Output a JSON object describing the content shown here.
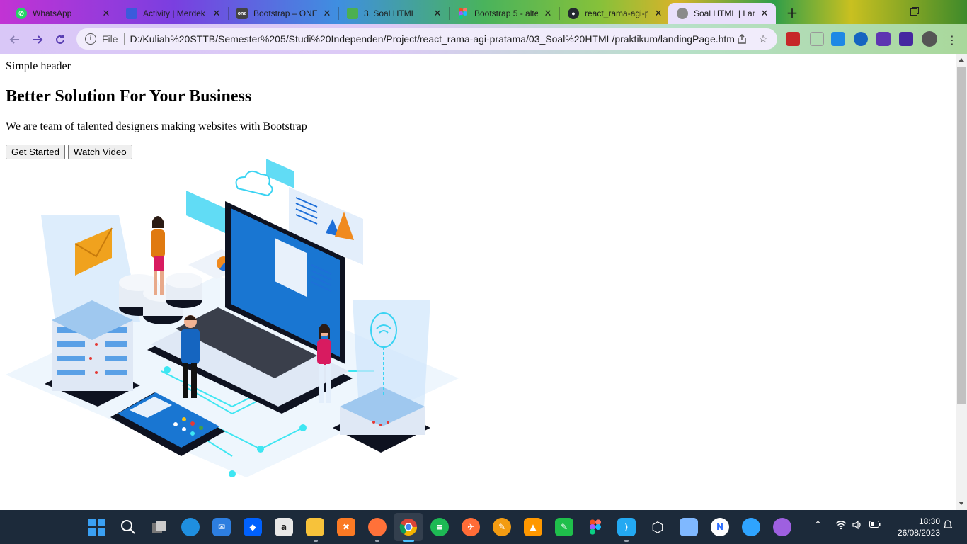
{
  "browser": {
    "tabs": [
      {
        "title": "WhatsApp",
        "icon": "whatsapp-icon",
        "color": "#25d366",
        "active": false
      },
      {
        "title": "Activity | Merdek",
        "icon": "kampus-merdeka-icon",
        "color": "#3b5bdb",
        "active": false
      },
      {
        "title": "Bootstrap – ONE",
        "icon": "one-icon",
        "color": "#444444",
        "active": false
      },
      {
        "title": "3. Soal HTML",
        "icon": "notebook-icon",
        "color": "#4caf50",
        "active": false
      },
      {
        "title": "Bootstrap 5 - alte",
        "icon": "figma-icon",
        "color": "#f24e1e",
        "active": false
      },
      {
        "title": "react_rama-agi-p",
        "icon": "github-icon",
        "color": "#24292f",
        "active": false
      },
      {
        "title": "Soal HTML | Landi",
        "icon": "globe-icon",
        "color": "#8a8a8a",
        "active": true
      }
    ],
    "close_glyph": "✕",
    "new_tab_glyph": "+",
    "address": {
      "scheme": "File",
      "url": "D:/Kuliah%20STTB/Semester%205/Studi%20Independen/Project/react_rama-agi-pratama/03_Soal%20HTML/praktikum/landingPage.html"
    }
  },
  "page": {
    "simple_header": "Simple header",
    "title": "Better Solution For Your Business",
    "subtitle": "We are team of talented designers making websites with Bootstrap",
    "buttons": {
      "get_started": "Get Started",
      "watch_video": "Watch Video"
    },
    "illustration": "isometric-laptop-datacenter-illustration"
  },
  "taskbar": {
    "apps": [
      {
        "name": "start-icon",
        "color": "#2f9bf0"
      },
      {
        "name": "search-icon",
        "color": "#1c2a3a"
      },
      {
        "name": "task-view-icon",
        "color": "#1c2a3a"
      },
      {
        "name": "edge-icon",
        "color": "#1f8fe0"
      },
      {
        "name": "mail-icon",
        "color": "#2d7ee0"
      },
      {
        "name": "dropbox-icon",
        "color": "#0061fe"
      },
      {
        "name": "amazon-icon",
        "color": "#e8e8e8"
      },
      {
        "name": "file-explorer-icon",
        "color": "#f7c23a"
      },
      {
        "name": "xampp-icon",
        "color": "#fb7a24"
      },
      {
        "name": "firefox-icon",
        "color": "#ff7139"
      },
      {
        "name": "chrome-icon",
        "color": "#4285f4"
      },
      {
        "name": "spotify-icon",
        "color": "#1db954"
      },
      {
        "name": "postman-icon",
        "color": "#ff6c37"
      },
      {
        "name": "pencil-icon",
        "color": "#f39c12"
      },
      {
        "name": "sublime-icon",
        "color": "#ff9800"
      },
      {
        "name": "maps-icon",
        "color": "#1fbf4b"
      },
      {
        "name": "figma-icon",
        "color": "#a259ff"
      },
      {
        "name": "vscode-icon",
        "color": "#23a9f2"
      },
      {
        "name": "virtualbox-icon",
        "color": "#bcd6f7"
      },
      {
        "name": "cube-icon",
        "color": "#7fb8ff"
      },
      {
        "name": "notion-icon",
        "color": "#2e6fff"
      },
      {
        "name": "cloud-icon",
        "color": "#2fa4ff"
      },
      {
        "name": "github-desktop-icon",
        "color": "#9e60e0"
      }
    ],
    "clock": {
      "time": "18:30",
      "date": "26/08/2023"
    }
  }
}
